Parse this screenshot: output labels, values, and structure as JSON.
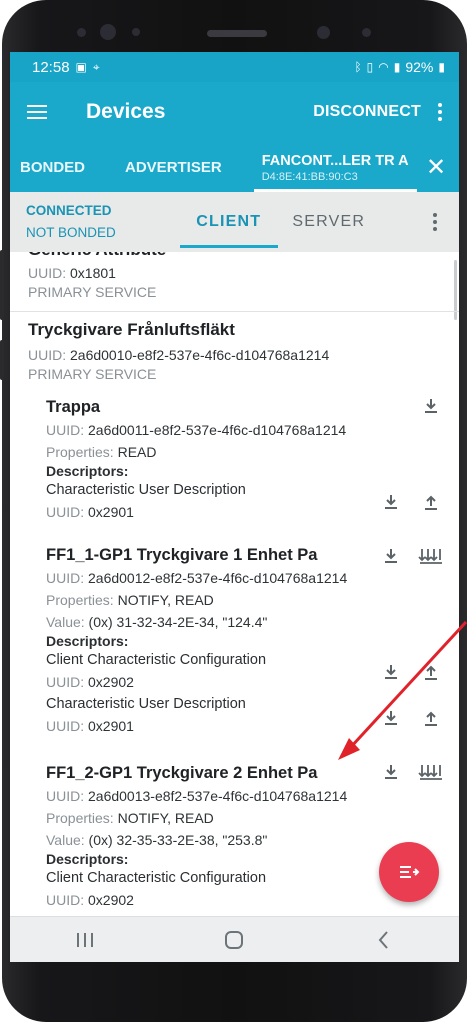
{
  "status_bar": {
    "time": "12:58",
    "battery": "92%"
  },
  "app_bar": {
    "title": "Devices",
    "disconnect": "DISCONNECT"
  },
  "tabs": {
    "bonded": "BONDED",
    "advertiser": "ADVERTISER",
    "device_title": "FANCONT...LER TR A",
    "device_address": "D4:8E:41:BB:90:C3"
  },
  "connection": {
    "state": "CONNECTED",
    "bond": "NOT BONDED",
    "client_tab": "CLIENT",
    "server_tab": "SERVER"
  },
  "services": [
    {
      "name": "Generic Attribute",
      "uuid_label": "UUID: ",
      "uuid": "0x1801",
      "type": "PRIMARY SERVICE"
    },
    {
      "name": "Tryckgivare Frånluftsfläkt",
      "uuid_label": "UUID: ",
      "uuid": "2a6d0010-e8f2-537e-4f6c-d104768a1214",
      "type": "PRIMARY SERVICE",
      "characteristics": [
        {
          "name": "Trappa",
          "uuid": "2a6d0011-e8f2-537e-4f6c-d104768a1214",
          "properties": "READ",
          "descriptors_label": "Descriptors:",
          "descriptors": [
            {
              "name": "Characteristic User Description",
              "uuid": "0x2901"
            }
          ]
        },
        {
          "name": "FF1_1-GP1 Tryckgivare 1 Enhet Pa",
          "uuid": "2a6d0012-e8f2-537e-4f6c-d104768a1214",
          "properties": "NOTIFY, READ",
          "value": "(0x) 31-32-34-2E-34, \"124.4\"",
          "descriptors_label": "Descriptors:",
          "descriptors": [
            {
              "name": "Client Characteristic Configuration",
              "uuid": "0x2902"
            },
            {
              "name": "Characteristic User Description",
              "uuid": "0x2901"
            }
          ]
        },
        {
          "name": "FF1_2-GP1 Tryckgivare 2 Enhet Pa",
          "uuid": "2a6d0013-e8f2-537e-4f6c-d104768a1214",
          "properties": "NOTIFY, READ",
          "value": "(0x) 32-35-33-2E-38, \"253.8\"",
          "descriptors_label": "Descriptors:",
          "descriptors": [
            {
              "name": "Client Characteristic Configuration",
              "uuid": "0x2902"
            }
          ]
        }
      ]
    }
  ],
  "labels": {
    "uuid": "UUID: ",
    "properties": "Properties: ",
    "value": "Value: "
  },
  "colors": {
    "primary": "#1ba9cb",
    "status_bar": "#17a4c6",
    "accent_text": "#1a93b4",
    "fab": "#ea3d52",
    "annotation_arrow": "#e0232b"
  },
  "icons": {
    "menu": "hamburger-menu-icon",
    "overflow": "more-vert-icon",
    "close": "close-icon",
    "read": "download-arrow-icon",
    "write": "upload-arrow-icon",
    "notify": "notify-multi-arrow-icon",
    "fab": "macro-list-icon",
    "nav_recents": "recents-icon",
    "nav_home": "home-icon",
    "nav_back": "back-icon"
  }
}
